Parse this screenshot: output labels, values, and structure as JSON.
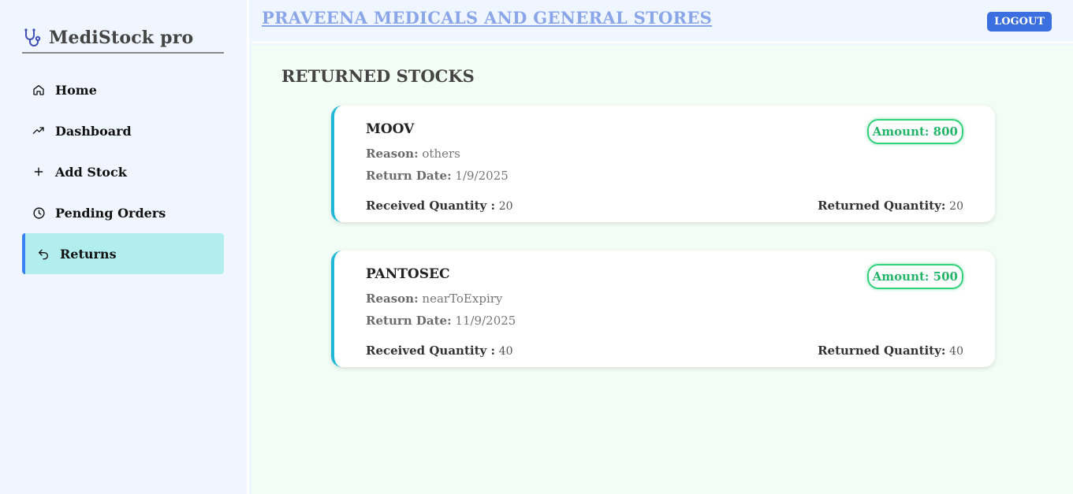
{
  "sidebar": {
    "brand": "MediStock pro",
    "items": [
      {
        "label": "Home",
        "icon": "home-icon"
      },
      {
        "label": "Dashboard",
        "icon": "trending-up-icon"
      },
      {
        "label": "Add Stock",
        "icon": "plus-icon"
      },
      {
        "label": "Pending Orders",
        "icon": "clock-icon"
      },
      {
        "label": "Returns",
        "icon": "undo-arrow-icon",
        "active": true
      }
    ]
  },
  "header": {
    "store_name": "PRAVEENA MEDICALS AND GENERAL STORES",
    "logout_label": "LOGOUT"
  },
  "main": {
    "title": "RETURNED STOCKS",
    "returns": [
      {
        "name": "MOOV",
        "amount": "Amount: 800",
        "reason_label": "Reason:",
        "reason": "others",
        "date_label": "Return Date:",
        "date": "1/9/2025",
        "received_label": "Received Quantity :",
        "received": "20",
        "returned_label": "Returned Quantity:",
        "returned": "20"
      },
      {
        "name": "PANTOSEC",
        "amount": "Amount: 500",
        "reason_label": "Reason:",
        "reason": "nearToExpiry",
        "date_label": "Return Date:",
        "date": "11/9/2025",
        "received_label": "Received Quantity :",
        "received": "40",
        "returned_label": "Returned Quantity:",
        "returned": "40"
      }
    ]
  },
  "colors": {
    "accent": "#3b6fe0",
    "active_nav_bg": "#b2eeee",
    "card_border": "#1fb8d6",
    "amount_green": "#22b568"
  }
}
